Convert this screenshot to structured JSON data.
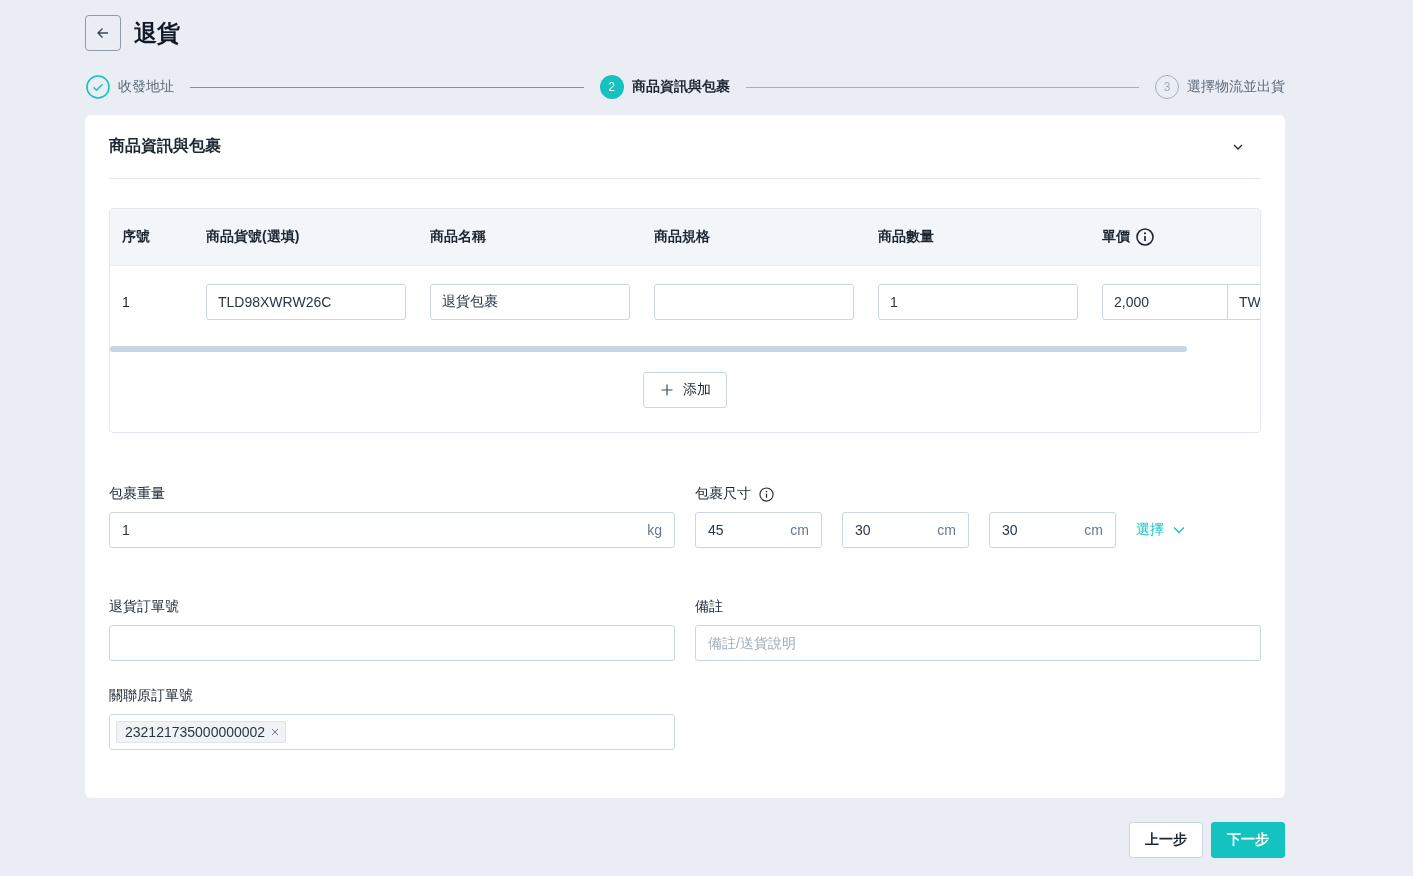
{
  "header": {
    "title": "退貨"
  },
  "steps": [
    {
      "label": "收發地址",
      "done": true,
      "selected": false
    },
    {
      "number": "2",
      "label": "商品資訊與包裹",
      "done": false,
      "selected": true
    },
    {
      "number": "3",
      "label": "選擇物流並出貨",
      "done": false,
      "selected": false
    }
  ],
  "section": {
    "title": "商品資訊與包裹",
    "expanded": true
  },
  "table": {
    "columns": [
      {
        "label": "序號",
        "info": false
      },
      {
        "label": "商品貨號(選填)",
        "info": false
      },
      {
        "label": "商品名稱",
        "info": false
      },
      {
        "label": "商品規格",
        "info": false
      },
      {
        "label": "商品數量",
        "info": false
      },
      {
        "label": "單價",
        "info": true
      }
    ],
    "rows": [
      {
        "index": "1",
        "sku": "TLD98XWRW26C",
        "name": "退貨包裹",
        "qty": "1",
        "price": "2,000",
        "currency": "TW"
      }
    ]
  },
  "add_button": {
    "label": "添加"
  },
  "weight": {
    "label": "包裹重量",
    "value": "1",
    "unit": "kg"
  },
  "dimensions": {
    "label": "包裹尺寸",
    "info": true,
    "fields": [
      {
        "value": "45",
        "unit": "cm"
      },
      {
        "value": "30",
        "unit": "cm"
      },
      {
        "value": "30",
        "unit": "cm"
      }
    ],
    "select": "選擇"
  },
  "return_order": {
    "label": "退貨訂單號"
  },
  "remark": {
    "label": "備註",
    "placeholder": "備註/送貨說明"
  },
  "related_order": {
    "label": "關聯原訂單號",
    "tags": [
      "232121735000000002"
    ]
  },
  "buttons": [
    {
      "label": "上一步",
      "kind": "secondary"
    },
    {
      "label": "下一步",
      "kind": "primary"
    }
  ]
}
